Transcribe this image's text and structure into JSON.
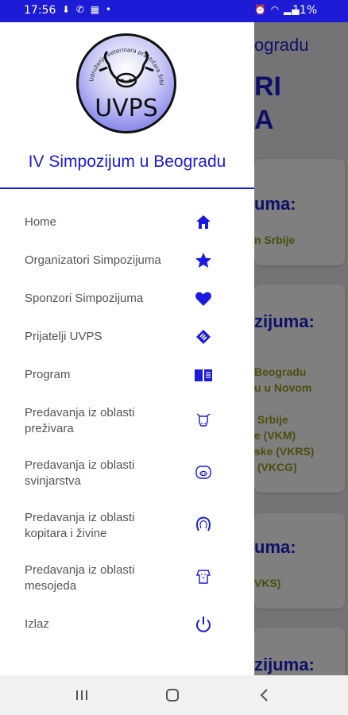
{
  "status_bar": {
    "time": "17:56",
    "battery": "11%",
    "left_icons": [
      "download-icon",
      "call-icon",
      "game-icon",
      "dot-icon"
    ],
    "right_icons": [
      "alarm-icon",
      "wifi-icon",
      "signal-icon",
      "signal-icon"
    ]
  },
  "logo": {
    "text": "UVPS",
    "ring_text": "Udruženje veterinara praktičara Srbije"
  },
  "drawer": {
    "title": "IV Simpozijum u Beogradu",
    "items": [
      {
        "label": "Home",
        "icon": "home-icon"
      },
      {
        "label": "Organizatori Simpozijuma",
        "icon": "star-icon"
      },
      {
        "label": "Sponzori Simpozijuma",
        "icon": "heart-icon"
      },
      {
        "label": "Prijatelji UVPS",
        "icon": "handshake-icon"
      },
      {
        "label": "Program",
        "icon": "book-icon"
      },
      {
        "label": "Predavanja iz oblasti\npreživara",
        "icon": "cow-icon"
      },
      {
        "label": "Predavanja iz oblasti\nsvinjarstva",
        "icon": "pig-icon"
      },
      {
        "label": "Predavanja iz oblasti\nkopitara i živine",
        "icon": "horseshoe-icon"
      },
      {
        "label": "Predavanja iz oblasti\nmesojeda",
        "icon": "dog-icon"
      },
      {
        "label": "Izlaz",
        "icon": "power-icon"
      }
    ]
  },
  "background": {
    "title": "ogradu",
    "big1": "RI",
    "big2": "A",
    "cards": [
      {
        "heading": "uma:",
        "text": "n Srbije"
      },
      {
        "heading": "zijuma:",
        "text": "Beogradu\nu u Novom\n\n Srbije\ne (VKM)\nske (VKRS)\n (VKCG)"
      },
      {
        "heading": "uma:",
        "text": "VKS)"
      },
      {
        "heading": "zijuma:",
        "text": ""
      }
    ]
  },
  "colors": {
    "accent": "#1a1ae0",
    "status_bar": "#1d1bd6",
    "bg_text": "#9a9a1a"
  },
  "nav_bar": {
    "buttons": [
      "recents-button",
      "home-button",
      "back-button"
    ]
  }
}
